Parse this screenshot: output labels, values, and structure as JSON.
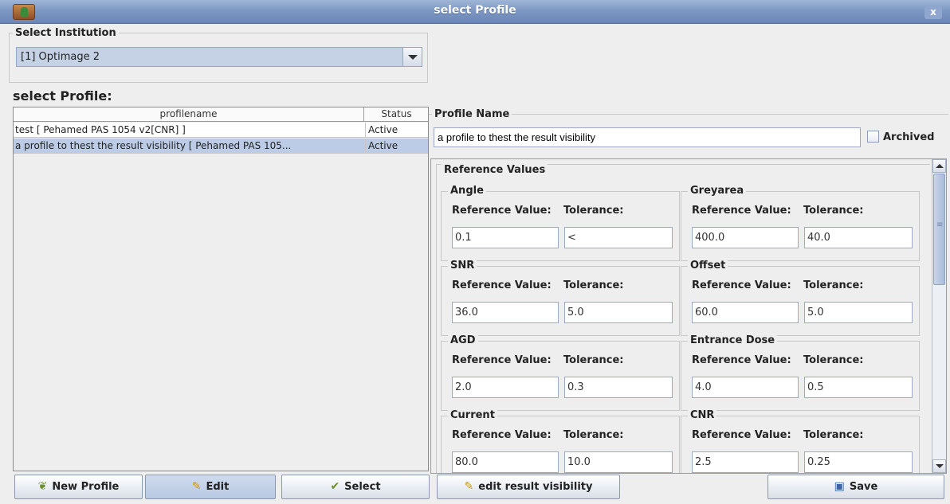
{
  "window": {
    "title": "select Profile",
    "close_label": "x"
  },
  "institution": {
    "group_label": "Select Institution",
    "selected": "[1] Optimage 2"
  },
  "section_title": "select Profile:",
  "table": {
    "columns": [
      "profilename",
      "Status"
    ],
    "rows": [
      {
        "name": "test [ Pehamed PAS 1054 v2[CNR] ]",
        "status": "Active",
        "selected": false
      },
      {
        "name": "a profile to thest the result visibility [ Pehamed PAS 105...",
        "status": "Active",
        "selected": true
      }
    ]
  },
  "profile": {
    "group_label": "Profile Name",
    "name_value": "a profile to thest the result visibility",
    "archived_label": "Archived"
  },
  "reference": {
    "group_label": "Reference Values",
    "ref_label": "Reference Value:",
    "tol_label": "Tolerance:",
    "params": [
      {
        "name": "Angle",
        "ref": "0.1",
        "tol": "<"
      },
      {
        "name": "Greyarea",
        "ref": "400.0",
        "tol": "40.0"
      },
      {
        "name": "SNR",
        "ref": "36.0",
        "tol": "5.0"
      },
      {
        "name": "Offset",
        "ref": "60.0",
        "tol": "5.0"
      },
      {
        "name": "AGD",
        "ref": "2.0",
        "tol": "0.3"
      },
      {
        "name": "Entrance Dose",
        "ref": "4.0",
        "tol": "0.5"
      },
      {
        "name": "Current",
        "ref": "80.0",
        "tol": "10.0"
      },
      {
        "name": "CNR",
        "ref": "2.5",
        "tol": "0.25"
      }
    ]
  },
  "buttons": {
    "new_profile": "New Profile",
    "edit": "Edit",
    "select": "Select",
    "edit_visibility": "edit result visibility",
    "save": "Save"
  },
  "icons": {
    "app": "app-icon",
    "new_profile": "leaf-icon",
    "edit": "pencil-icon",
    "select": "leaf-check-icon",
    "edit_visibility": "pencil-icon",
    "save": "floppy-disk-icon"
  },
  "colors": {
    "title_bar": "#7e98c4",
    "selection": "#bccce6",
    "combo_bg": "#c5d2e6"
  }
}
